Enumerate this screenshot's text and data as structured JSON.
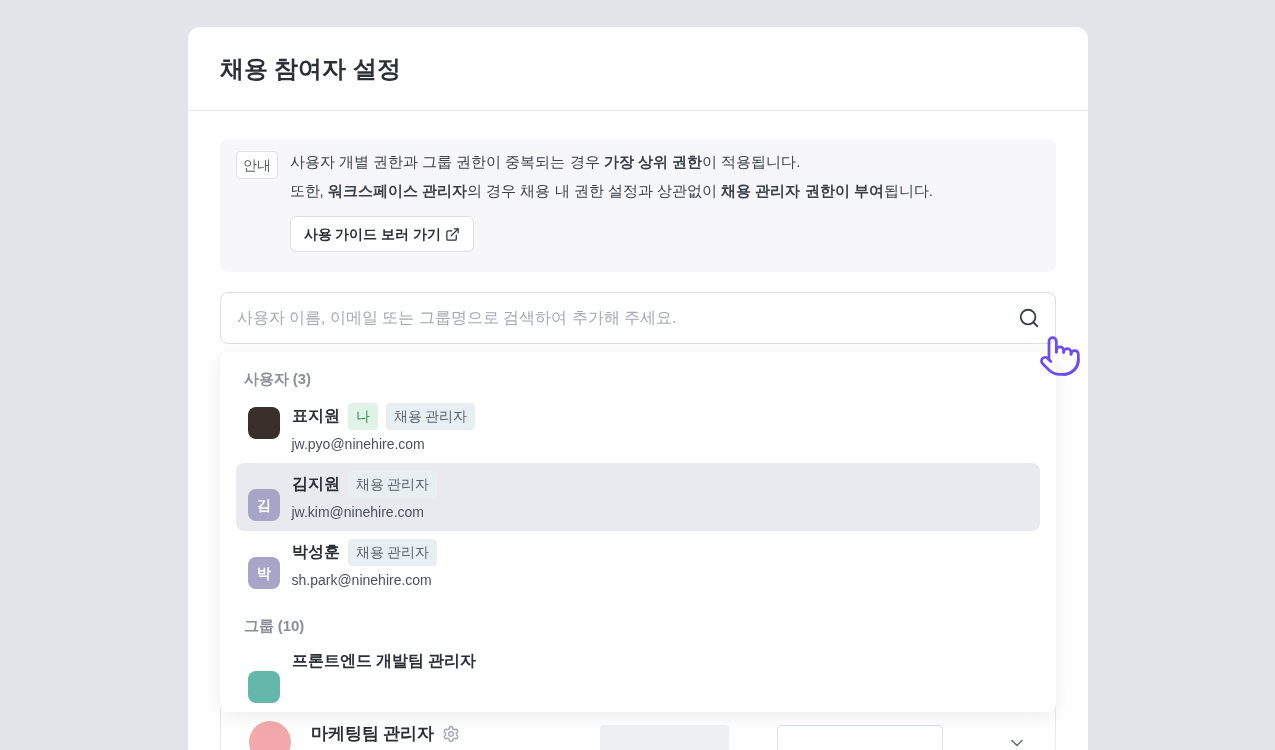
{
  "dialog": {
    "title": "채용 참여자 설정"
  },
  "notice": {
    "badge": "안내",
    "lines": [
      "사용자 개별 권한과 그룹 권한이 중복되는 경우 **가장 상위 권한**이 적용됩니다.",
      "또한, **워크스페이스 관리자**의 경우 채용 내 권한 설정과 상관없이 **채용 관리자 권한이 부여**됩니다."
    ],
    "guide_button": "사용 가이드 보러 가기"
  },
  "search": {
    "placeholder": "사용자 이름, 이메일 또는 그룹명으로 검색하여 추가해 주세요."
  },
  "dropdown": {
    "sections": [
      {
        "title": "사용자 (3)",
        "items": [
          {
            "kind": "photo",
            "name": "표지원",
            "me_badge": "나",
            "role": "채용 관리자",
            "email": "jw.pyo@ninehire.com",
            "selected": false
          },
          {
            "kind": "initial",
            "initial": "김",
            "name": "김지원",
            "role": "채용 관리자",
            "email": "jw.kim@ninehire.com",
            "selected": true
          },
          {
            "kind": "initial",
            "initial": "박",
            "name": "박성훈",
            "role": "채용 관리자",
            "email": "sh.park@ninehire.com",
            "selected": false
          }
        ]
      },
      {
        "title": "그룹 (10)",
        "items": [
          {
            "kind": "group",
            "name": "프론트엔드 개발팀 관리자",
            "color": "#63b8ab",
            "selected": false
          }
        ]
      }
    ]
  },
  "members": [
    {
      "name": "마케팅팀 관리자",
      "color": "#f3a9ab"
    }
  ]
}
